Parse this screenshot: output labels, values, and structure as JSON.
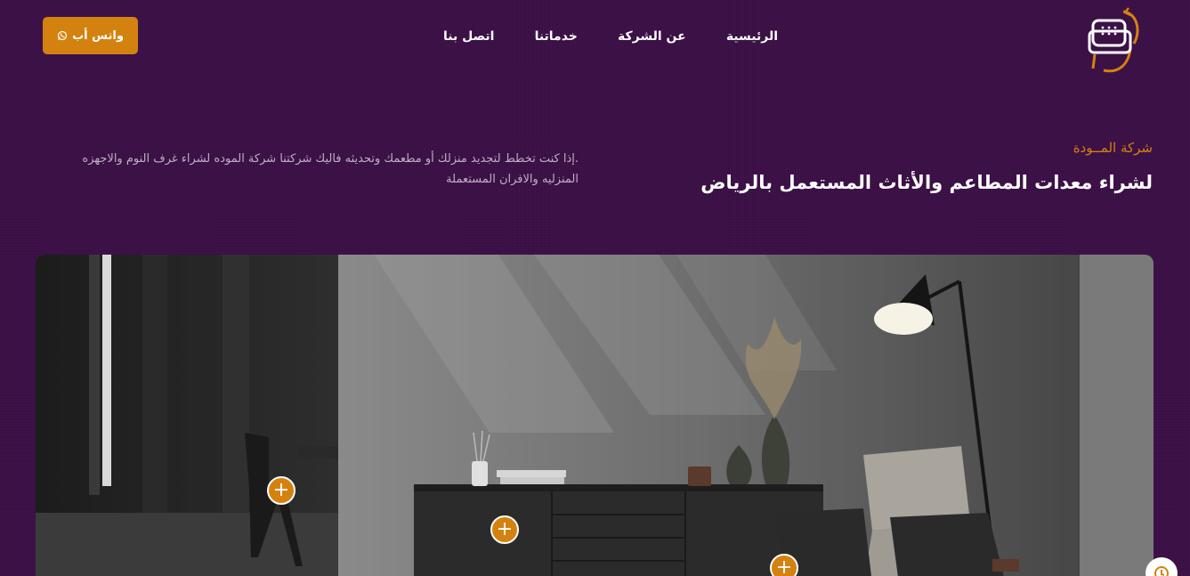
{
  "header": {
    "whatsapp_label": "واتس أب",
    "nav": [
      {
        "label": "الرئيسية"
      },
      {
        "label": "عن الشركة"
      },
      {
        "label": "خدماتنا"
      },
      {
        "label": "اتصل بنا"
      }
    ]
  },
  "hero": {
    "eyebrow": "شركة المــودة",
    "headline": "لشراء معدات المطاعم والأثاث المستعمل بالرياض",
    "description": ".إذا كنت تخطط لتجديد منزلك أو مطعمك وتحديثه فاليك شركتنا شركة الموده لشراء غرف النوم والاجهزه المنزليه والافران المستعملة"
  },
  "hotspots": [
    {
      "label": "+"
    },
    {
      "label": "+"
    },
    {
      "label": "+"
    }
  ],
  "colors": {
    "background": "#3a0f45",
    "accent": "#d4820f"
  }
}
